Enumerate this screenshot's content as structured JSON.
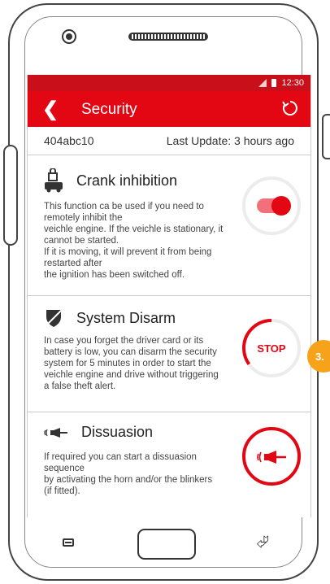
{
  "status": {
    "time": "12:30"
  },
  "appbar": {
    "back_icon": "chevron-left-icon",
    "title": "Security",
    "refresh_icon": "refresh-icon"
  },
  "info": {
    "plate": "404abc10",
    "last_update": "Last Update: 3 hours ago"
  },
  "crank": {
    "title": "Crank inhibition",
    "icon": "lock-car-icon",
    "description": "This function ca be used if you need to\nremotely inhibit the\nveichle engine. If the veichle is stationary, it\ncannot be started.\nIf it is moving, it will prevent it from being\nrestarted after\nthe ignition has been switched off.",
    "toggle_on": true
  },
  "disarm": {
    "title": "System Disarm",
    "icon": "shield-off-icon",
    "description": "In case you forget the driver card or its\nbattery is low, you can disarm the security\nsystem for 5 minutes in order to start the\nveichle engine and drive without triggering\na false theft alert.",
    "button_label": "STOP",
    "progress_fraction": 0.35
  },
  "dissuasion": {
    "title": "Dissuasion",
    "icon": "horn-icon",
    "description": "If required you can start a dissuasion\nsequence\nby activating the horn and/or the blinkers\n(if fitted)."
  },
  "annotation": {
    "label": "3.",
    "color": "#f7a21b"
  },
  "colors": {
    "accent": "#e30613",
    "statusbar": "#c9101a"
  }
}
